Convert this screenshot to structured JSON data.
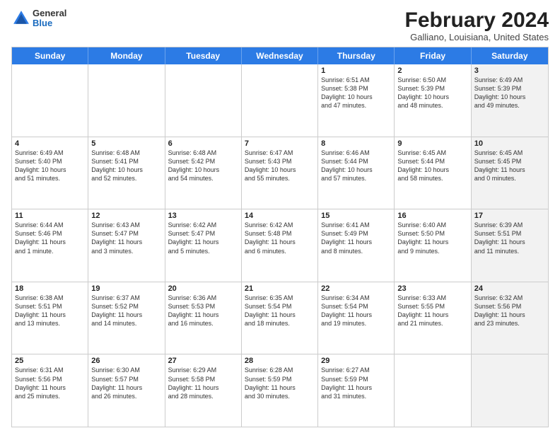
{
  "header": {
    "logo": {
      "line1": "General",
      "line2": "Blue"
    },
    "title": "February 2024",
    "subtitle": "Galliano, Louisiana, United States"
  },
  "days_of_week": [
    "Sunday",
    "Monday",
    "Tuesday",
    "Wednesday",
    "Thursday",
    "Friday",
    "Saturday"
  ],
  "weeks": [
    [
      {
        "day": "",
        "lines": [],
        "shaded": false
      },
      {
        "day": "",
        "lines": [],
        "shaded": false
      },
      {
        "day": "",
        "lines": [],
        "shaded": false
      },
      {
        "day": "",
        "lines": [],
        "shaded": false
      },
      {
        "day": "1",
        "lines": [
          "Sunrise: 6:51 AM",
          "Sunset: 5:38 PM",
          "Daylight: 10 hours",
          "and 47 minutes."
        ],
        "shaded": false
      },
      {
        "day": "2",
        "lines": [
          "Sunrise: 6:50 AM",
          "Sunset: 5:39 PM",
          "Daylight: 10 hours",
          "and 48 minutes."
        ],
        "shaded": false
      },
      {
        "day": "3",
        "lines": [
          "Sunrise: 6:49 AM",
          "Sunset: 5:39 PM",
          "Daylight: 10 hours",
          "and 49 minutes."
        ],
        "shaded": true
      }
    ],
    [
      {
        "day": "4",
        "lines": [
          "Sunrise: 6:49 AM",
          "Sunset: 5:40 PM",
          "Daylight: 10 hours",
          "and 51 minutes."
        ],
        "shaded": false
      },
      {
        "day": "5",
        "lines": [
          "Sunrise: 6:48 AM",
          "Sunset: 5:41 PM",
          "Daylight: 10 hours",
          "and 52 minutes."
        ],
        "shaded": false
      },
      {
        "day": "6",
        "lines": [
          "Sunrise: 6:48 AM",
          "Sunset: 5:42 PM",
          "Daylight: 10 hours",
          "and 54 minutes."
        ],
        "shaded": false
      },
      {
        "day": "7",
        "lines": [
          "Sunrise: 6:47 AM",
          "Sunset: 5:43 PM",
          "Daylight: 10 hours",
          "and 55 minutes."
        ],
        "shaded": false
      },
      {
        "day": "8",
        "lines": [
          "Sunrise: 6:46 AM",
          "Sunset: 5:44 PM",
          "Daylight: 10 hours",
          "and 57 minutes."
        ],
        "shaded": false
      },
      {
        "day": "9",
        "lines": [
          "Sunrise: 6:45 AM",
          "Sunset: 5:44 PM",
          "Daylight: 10 hours",
          "and 58 minutes."
        ],
        "shaded": false
      },
      {
        "day": "10",
        "lines": [
          "Sunrise: 6:45 AM",
          "Sunset: 5:45 PM",
          "Daylight: 11 hours",
          "and 0 minutes."
        ],
        "shaded": true
      }
    ],
    [
      {
        "day": "11",
        "lines": [
          "Sunrise: 6:44 AM",
          "Sunset: 5:46 PM",
          "Daylight: 11 hours",
          "and 1 minute."
        ],
        "shaded": false
      },
      {
        "day": "12",
        "lines": [
          "Sunrise: 6:43 AM",
          "Sunset: 5:47 PM",
          "Daylight: 11 hours",
          "and 3 minutes."
        ],
        "shaded": false
      },
      {
        "day": "13",
        "lines": [
          "Sunrise: 6:42 AM",
          "Sunset: 5:47 PM",
          "Daylight: 11 hours",
          "and 5 minutes."
        ],
        "shaded": false
      },
      {
        "day": "14",
        "lines": [
          "Sunrise: 6:42 AM",
          "Sunset: 5:48 PM",
          "Daylight: 11 hours",
          "and 6 minutes."
        ],
        "shaded": false
      },
      {
        "day": "15",
        "lines": [
          "Sunrise: 6:41 AM",
          "Sunset: 5:49 PM",
          "Daylight: 11 hours",
          "and 8 minutes."
        ],
        "shaded": false
      },
      {
        "day": "16",
        "lines": [
          "Sunrise: 6:40 AM",
          "Sunset: 5:50 PM",
          "Daylight: 11 hours",
          "and 9 minutes."
        ],
        "shaded": false
      },
      {
        "day": "17",
        "lines": [
          "Sunrise: 6:39 AM",
          "Sunset: 5:51 PM",
          "Daylight: 11 hours",
          "and 11 minutes."
        ],
        "shaded": true
      }
    ],
    [
      {
        "day": "18",
        "lines": [
          "Sunrise: 6:38 AM",
          "Sunset: 5:51 PM",
          "Daylight: 11 hours",
          "and 13 minutes."
        ],
        "shaded": false
      },
      {
        "day": "19",
        "lines": [
          "Sunrise: 6:37 AM",
          "Sunset: 5:52 PM",
          "Daylight: 11 hours",
          "and 14 minutes."
        ],
        "shaded": false
      },
      {
        "day": "20",
        "lines": [
          "Sunrise: 6:36 AM",
          "Sunset: 5:53 PM",
          "Daylight: 11 hours",
          "and 16 minutes."
        ],
        "shaded": false
      },
      {
        "day": "21",
        "lines": [
          "Sunrise: 6:35 AM",
          "Sunset: 5:54 PM",
          "Daylight: 11 hours",
          "and 18 minutes."
        ],
        "shaded": false
      },
      {
        "day": "22",
        "lines": [
          "Sunrise: 6:34 AM",
          "Sunset: 5:54 PM",
          "Daylight: 11 hours",
          "and 19 minutes."
        ],
        "shaded": false
      },
      {
        "day": "23",
        "lines": [
          "Sunrise: 6:33 AM",
          "Sunset: 5:55 PM",
          "Daylight: 11 hours",
          "and 21 minutes."
        ],
        "shaded": false
      },
      {
        "day": "24",
        "lines": [
          "Sunrise: 6:32 AM",
          "Sunset: 5:56 PM",
          "Daylight: 11 hours",
          "and 23 minutes."
        ],
        "shaded": true
      }
    ],
    [
      {
        "day": "25",
        "lines": [
          "Sunrise: 6:31 AM",
          "Sunset: 5:56 PM",
          "Daylight: 11 hours",
          "and 25 minutes."
        ],
        "shaded": false
      },
      {
        "day": "26",
        "lines": [
          "Sunrise: 6:30 AM",
          "Sunset: 5:57 PM",
          "Daylight: 11 hours",
          "and 26 minutes."
        ],
        "shaded": false
      },
      {
        "day": "27",
        "lines": [
          "Sunrise: 6:29 AM",
          "Sunset: 5:58 PM",
          "Daylight: 11 hours",
          "and 28 minutes."
        ],
        "shaded": false
      },
      {
        "day": "28",
        "lines": [
          "Sunrise: 6:28 AM",
          "Sunset: 5:59 PM",
          "Daylight: 11 hours",
          "and 30 minutes."
        ],
        "shaded": false
      },
      {
        "day": "29",
        "lines": [
          "Sunrise: 6:27 AM",
          "Sunset: 5:59 PM",
          "Daylight: 11 hours",
          "and 31 minutes."
        ],
        "shaded": false
      },
      {
        "day": "",
        "lines": [],
        "shaded": false
      },
      {
        "day": "",
        "lines": [],
        "shaded": true
      }
    ]
  ]
}
